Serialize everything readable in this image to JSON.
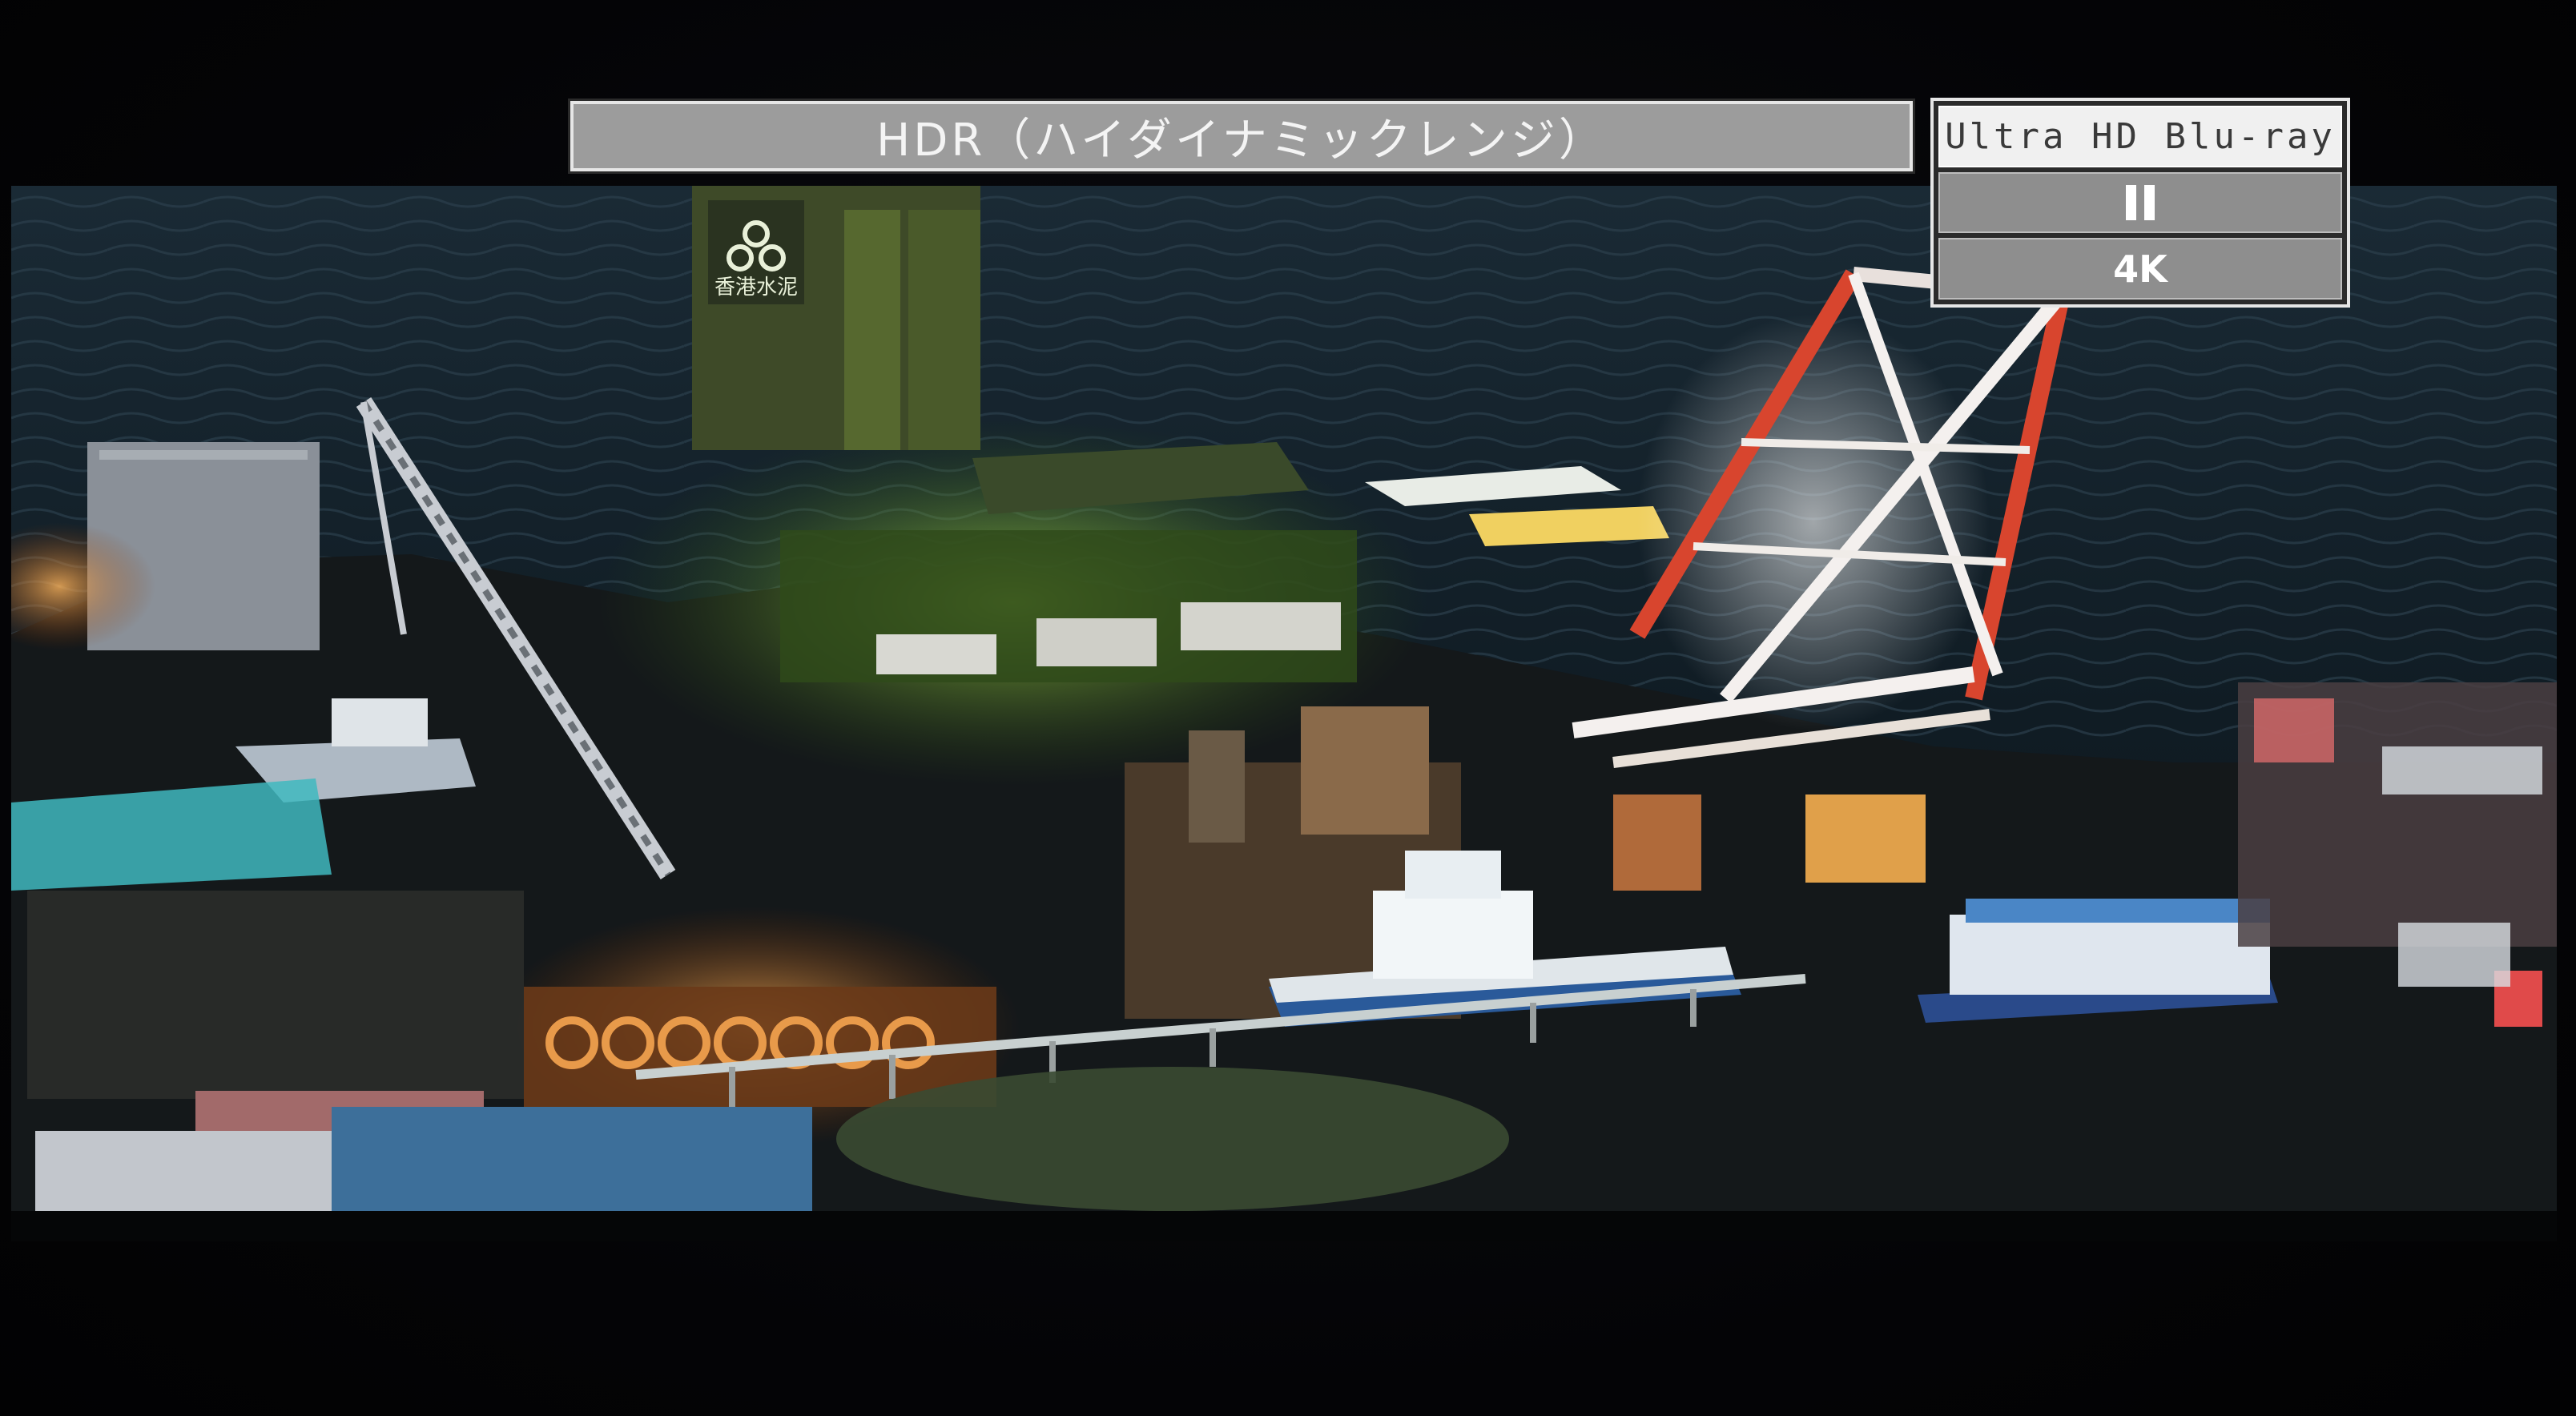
{
  "osd": {
    "hdr_label": "HDR（ハイダイナミックレンジ）",
    "source_label": "Ultra HD Blu-ray",
    "play_state_icon": "pause-icon",
    "resolution_label": "4K"
  },
  "scene": {
    "signage_text": "香港水泥"
  },
  "colors": {
    "osd_fill": "#9c9c9c",
    "osd_border": "#e6e6e6",
    "source_fill": "#f0f0f0",
    "crane_red": "#d8452e",
    "dock_green": "#a6e04a"
  }
}
